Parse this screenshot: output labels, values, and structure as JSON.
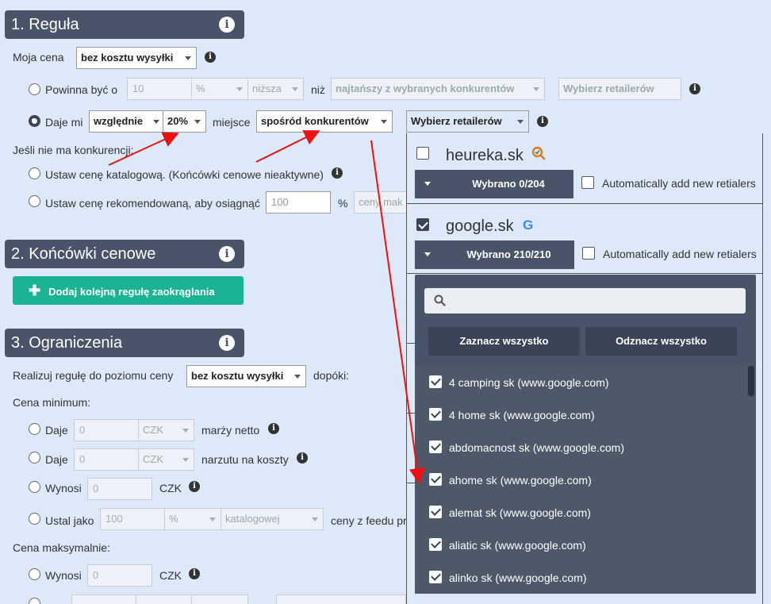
{
  "section1": {
    "title": "1. Reguła"
  },
  "my_price": {
    "label": "Moja cena",
    "select": "bez kosztu wysyłki"
  },
  "opt_should": {
    "label": "Powinna być o",
    "value": "10",
    "unit": "%",
    "dir": "niższa",
    "than": "niż",
    "competitor": "najtańszy z wybranych konkurentów",
    "retailers": "Wybierz retailerów"
  },
  "opt_give": {
    "label": "Daje mi",
    "mode": "względnie",
    "pct": "20%",
    "place": "miejsce",
    "among": "spośród konkurentów",
    "retailers": "Wybierz retailerów"
  },
  "no_comp": {
    "label": "Jeśli nie ma konkurencji:",
    "opt1": "Ustaw cenę katalogową. (Końcówki cenowe nieaktywne)",
    "opt2": "Ustaw cenę rekomendowaną, aby osiągnąć",
    "value": "100",
    "unit": "%",
    "tail": "ceny mak"
  },
  "section2": {
    "title": "2. Końcówki cenowe",
    "button": "Dodaj kolejną regułę zaokrąglania"
  },
  "section3": {
    "title": "3. Ograniczenia",
    "realize": "Realizuj regułę do poziomu ceny",
    "realize_select": "bez kosztu wysyłki",
    "until": "dopóki:"
  },
  "min": {
    "label": "Cena minimum:",
    "give1": "Daje",
    "v1": "0",
    "cur1": "CZK",
    "tail1": "marży netto",
    "give2": "Daje",
    "v2": "0",
    "cur2": "CZK",
    "tail2": "narzutu na koszty",
    "amounts": "Wynosi",
    "v3": "0",
    "cur3": "CZK",
    "set_as": "Ustal jako",
    "v4": "100",
    "unit4": "%",
    "catalog": "katalogowej",
    "tail4": "ceny z feedu prod"
  },
  "max": {
    "label": "Cena maksymalnie:",
    "amounts": "Wynosi",
    "v1": "0",
    "cur1": "CZK"
  },
  "retailers": [
    {
      "name": "heureka.sk",
      "checked": false,
      "selected": "Wybrano 0/204",
      "auto": "Automatically add new retialers"
    },
    {
      "name": "google.sk",
      "checked": true,
      "selected": "Wybrano 210/210",
      "auto": "Automatically add new retialers"
    }
  ],
  "dropdown": {
    "select_all": "Zaznacz wszystko",
    "deselect_all": "Odznacz wszystko",
    "items": [
      "4 camping sk (www.google.com)",
      "4 home sk (www.google.com)",
      "abdomacnost sk (www.google.com)",
      "ahome sk (www.google.com)",
      "alemat sk (www.google.com)",
      "aliatic sk (www.google.com)",
      "alinko sk (www.google.com)"
    ]
  },
  "colors": {
    "header": "#495468",
    "accent": "#1ab394",
    "bg": "#dde8f8",
    "arrow": "#ee1111"
  }
}
